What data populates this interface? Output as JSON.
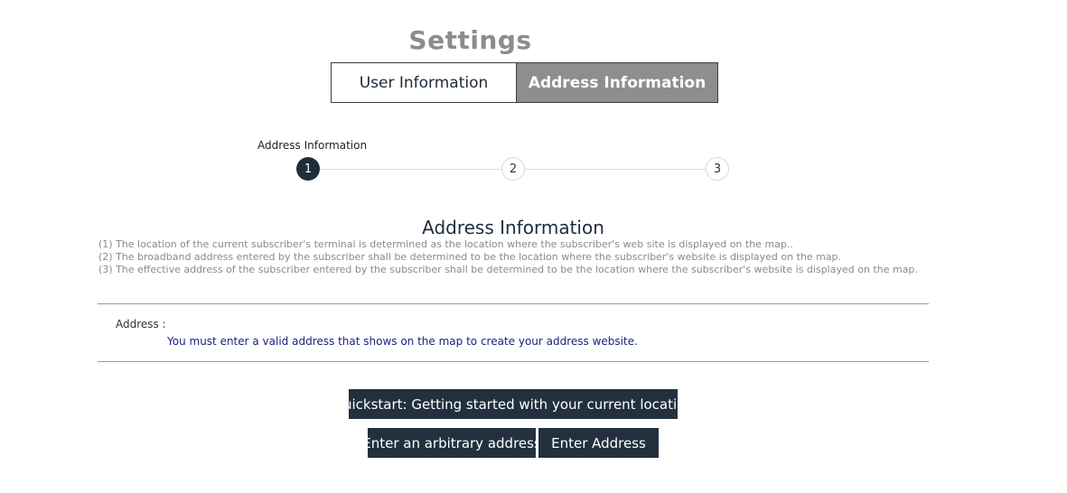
{
  "header": {
    "title": "Settings",
    "tabs": [
      {
        "label": "User Information",
        "active": false
      },
      {
        "label": "Address Information",
        "active": true
      }
    ]
  },
  "stepper": {
    "caption": "Address Information",
    "steps": [
      "1",
      "2",
      "3"
    ],
    "current_step": 1
  },
  "section": {
    "title": "Address Information",
    "notes": [
      "(1) The location of the current subscriber's terminal is determined as the location where the subscriber's web site is displayed on the map..",
      "(2) The broadband address entered by the subscriber shall be determined to be the location where the subscriber's website is displayed on the map.",
      "(3) The effective address of the subscriber entered by the subscriber shall be determined to be the location where the subscriber's website is displayed on the map."
    ]
  },
  "address": {
    "label": "Address :",
    "hint": "You must enter a valid address that shows on the map to create your address website."
  },
  "buttons": {
    "quickstart": "Quickstart: Getting started with your current location",
    "arbitrary": "Enter an arbitrary address",
    "enter": "Enter Address"
  },
  "colors": {
    "tab_active_bg": "#8e8e8e",
    "button_bg": "#22303f",
    "step_active_bg": "#1f2d3d",
    "hint_text": "#1a237e"
  }
}
